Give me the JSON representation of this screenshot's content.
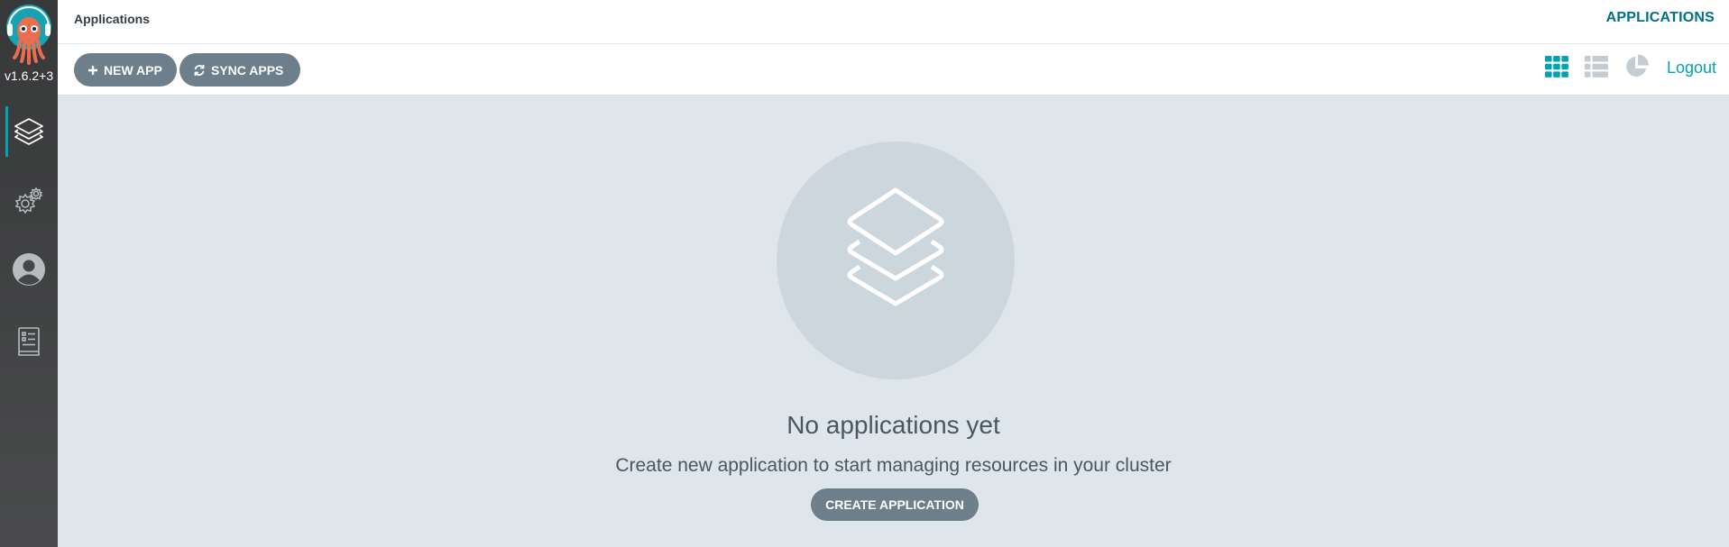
{
  "sidebar": {
    "version": "v1.6.2+3",
    "items": [
      {
        "name": "applications",
        "icon": "layers-icon",
        "active": true
      },
      {
        "name": "settings",
        "icon": "gears-icon",
        "active": false
      },
      {
        "name": "user-info",
        "icon": "user-circle-icon",
        "active": false
      },
      {
        "name": "documentation",
        "icon": "book-icon",
        "active": false
      }
    ]
  },
  "header": {
    "title": "Applications",
    "top_right": "APPLICATIONS"
  },
  "toolbar": {
    "new_app_label": "NEW APP",
    "sync_apps_label": "SYNC APPS",
    "views": [
      {
        "name": "tiles-view",
        "icon": "grid-icon",
        "active": true
      },
      {
        "name": "list-view",
        "icon": "list-icon",
        "active": false
      },
      {
        "name": "summary-view",
        "icon": "pie-chart-icon",
        "active": false
      }
    ],
    "logout_label": "Logout"
  },
  "empty_state": {
    "icon": "layers-icon",
    "title": "No applications yet",
    "subtitle": "Create new application to start managing resources in your cluster",
    "create_label": "CREATE APPLICATION"
  },
  "colors": {
    "accent": "#00a2b3",
    "button": "#6d7f8b",
    "background": "#dee6eb"
  }
}
